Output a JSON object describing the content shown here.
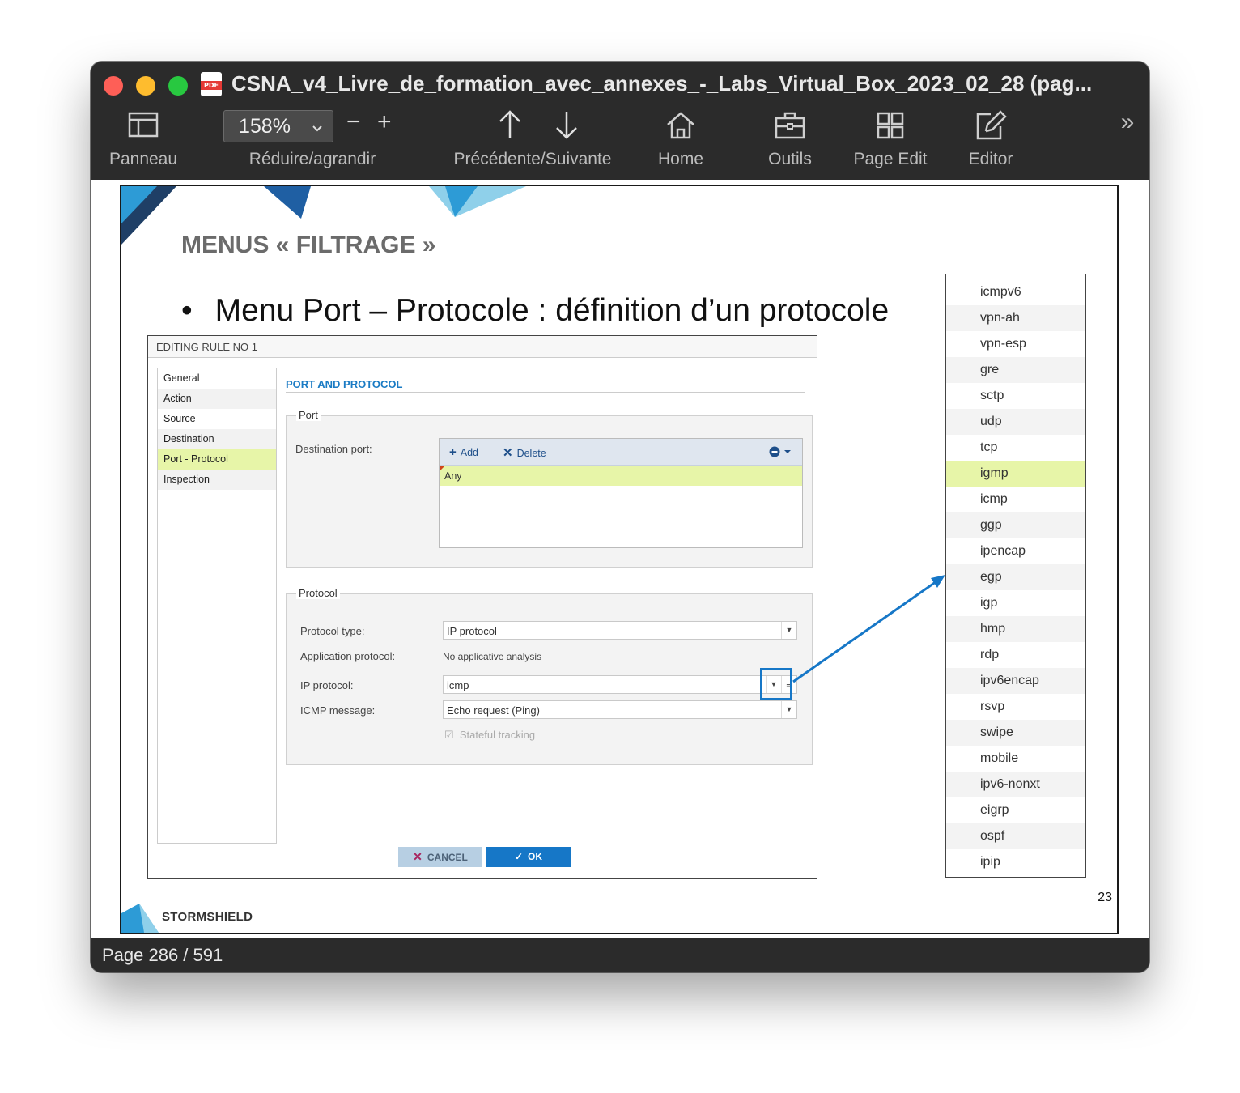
{
  "window": {
    "title": "CSNA_v4_Livre_de_formation_avec_annexes_-_Labs_Virtual_Box_2023_02_28 (pag...",
    "app_icon_label": "PDF"
  },
  "toolbar": {
    "panel_label": "Panneau",
    "zoom_value": "158%",
    "zoom_minus": "−",
    "zoom_plus": "+",
    "zoom_label": "Réduire/agrandir",
    "nav_label": "Précédente/Suivante",
    "home_label": "Home",
    "tools_label": "Outils",
    "page_edit_label": "Page Edit",
    "editor_label": "Editor",
    "more_label": "»"
  },
  "status": {
    "page": "Page 286 / 591"
  },
  "slide": {
    "title": "MENUS « FILTRAGE »",
    "bullet": "Menu Port – Protocole : définition d’un protocole",
    "bullet_dot": "•",
    "page_number": "23",
    "logo": "STORMSHIELD"
  },
  "dialog": {
    "header": "EDITING RULE NO 1",
    "nav": [
      "General",
      "Action",
      "Source",
      "Destination",
      "Port - Protocol",
      "Inspection"
    ],
    "active_nav": "Port - Protocol",
    "section_title": "PORT AND PROTOCOL",
    "port": {
      "legend": "Port",
      "destination_label": "Destination port:",
      "add": "Add",
      "delete": "Delete",
      "row": "Any"
    },
    "protocol": {
      "legend": "Protocol",
      "type_label": "Protocol type:",
      "type_value": "IP protocol",
      "app_label": "Application protocol:",
      "app_value": "No applicative analysis",
      "ip_label": "IP protocol:",
      "ip_value": "icmp",
      "icmp_label": "ICMP message:",
      "icmp_value": "Echo request (Ping)",
      "stateful": "Stateful tracking"
    },
    "cancel": "CANCEL",
    "ok": "OK"
  },
  "protocols": [
    "icmpv6",
    "vpn-ah",
    "vpn-esp",
    "gre",
    "sctp",
    "udp",
    "tcp",
    "igmp",
    "icmp",
    "ggp",
    "ipencap",
    "egp",
    "igp",
    "hmp",
    "rdp",
    "ipv6encap",
    "rsvp",
    "swipe",
    "mobile",
    "ipv6-nonxt",
    "eigrp",
    "ospf",
    "ipip"
  ],
  "selected_protocol": "igmp",
  "colors": {
    "accent_blue": "#1677c7",
    "highlight_green": "#e7f5a8",
    "window_dark": "#2b2b2b"
  }
}
